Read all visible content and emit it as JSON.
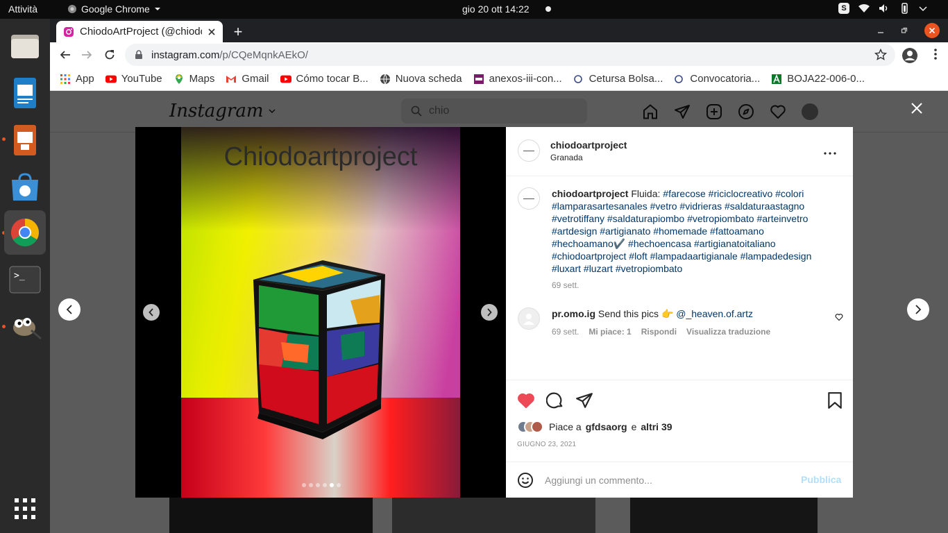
{
  "topbar": {
    "activities": "Attività",
    "app_name": "Google Chrome",
    "clock": "gio 20 ott  14:22",
    "tray_badge": "S"
  },
  "chrome": {
    "tab_title": "ChiodoArtProject (@chiodoartproject)",
    "url_host": "instagram.com",
    "url_path": "/p/CQeMqnkAEkO/",
    "bookmarks": [
      {
        "label": "App",
        "icon": "apps-grid-icon",
        "color": "#e94235"
      },
      {
        "label": "YouTube",
        "icon": "youtube-icon",
        "color": "#ff0000"
      },
      {
        "label": "Maps",
        "icon": "maps-icon",
        "color": "#34a853"
      },
      {
        "label": "Gmail",
        "icon": "gmail-icon",
        "color": "#ea4335"
      },
      {
        "label": "Cómo tocar B...",
        "icon": "youtube-icon",
        "color": "#ff0000"
      },
      {
        "label": "Nuova scheda",
        "icon": "globe-icon",
        "color": "#444444"
      },
      {
        "label": "anexos-iii-con...",
        "icon": "site-icon",
        "color": "#7a1b6a"
      },
      {
        "label": "Cetursa Bolsa...",
        "icon": "circle-icon",
        "color": "#3a4a8a"
      },
      {
        "label": "Convocatoria...",
        "icon": "circle-icon",
        "color": "#3a4a8a"
      },
      {
        "label": "BOJA22-006-0...",
        "icon": "boja-icon",
        "color": "#0a7a2a"
      }
    ]
  },
  "instagram": {
    "logo": "Instagram",
    "search_value": "chio"
  },
  "post": {
    "username": "chiodoartproject",
    "location": "Granada",
    "image_watermark": "Chiodoartproject",
    "carousel": {
      "count": 6,
      "active_index": 4
    },
    "caption": {
      "username": "chiodoartproject",
      "text": "Fluida:",
      "hashtags": "#farecose #riciclocreativo #colori #lamparasartesanales #vetro #vidrieras #saldaturaastagno #vetrotiffany #saldaturapiombo #vetropiombato #arteinvetro #artdesign #artigianato #homemade #fattoamano #hechoamano✔️ #hechoencasa #artigianatoitaliano #chiodoartproject #loft #lampadaartigianale #lampadedesign #luxart #luzart #vetropiombato",
      "time": "69 sett."
    },
    "comment": {
      "username": "pr.omo.ig",
      "text": "Send this pics 👉",
      "mention": "@_heaven.of.artz",
      "time": "69 sett.",
      "likes": "Mi piace: 1",
      "reply": "Rispondi",
      "translate": "Visualizza traduzione"
    },
    "likes": {
      "prefix": "Piace a",
      "user": "gfdsaorg",
      "joiner": "e",
      "others": "altri 39"
    },
    "date": "GIUGNO 23, 2021",
    "comment_placeholder": "Aggiungi un commento...",
    "publish_label": "Pubblica",
    "liked": true,
    "like_color": "#ed4956"
  }
}
